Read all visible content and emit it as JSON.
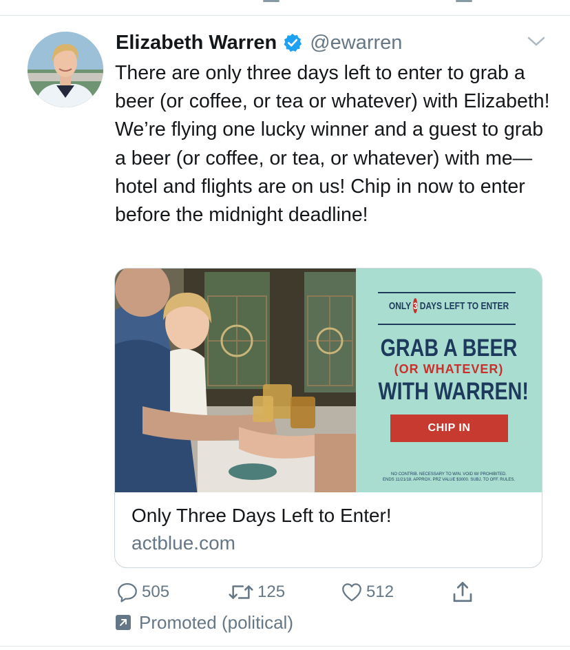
{
  "tweet": {
    "author_name": "Elizabeth Warren",
    "handle": "@ewarren",
    "text": "There are only three days left to enter to grab a beer (or coffee, or tea or whatever) with Elizabeth! We’re flying one lucky winner and a guest to grab a beer (or coffee, or tea, or whatever) with me—hotel and flights are on us! Chip in now to enter before the midnight deadline!"
  },
  "card": {
    "promo_only_prefix": "ONLY",
    "promo_days_number": "3",
    "promo_only_suffix": "DAYS LEFT TO ENTER",
    "promo_headline_1": "GRAB A BEER",
    "promo_headline_sub": "(OR WHATEVER)",
    "promo_headline_2": "WITH WARREN!",
    "promo_cta": "CHIP IN",
    "promo_fineprint_1": "No contrib. necessary to win. Void w/ prohibited.",
    "promo_fineprint_2": "Ends 11/21/18. Approx. prz value $3000. Subj. to off. rules.",
    "title": "Only Three Days Left to Enter!",
    "domain": "actblue.com"
  },
  "actions": {
    "replies": "505",
    "retweets": "125",
    "likes": "512"
  },
  "promoted_label": "Promoted (political)",
  "colors": {
    "verified_blue": "#1da1f2",
    "promo_mint": "#a9ddd0",
    "promo_navy": "#1d3a5c",
    "promo_red": "#c73a30",
    "muted_gray": "#657786"
  },
  "icons": [
    "verified-badge-icon",
    "chevron-down-icon",
    "reply-icon",
    "retweet-icon",
    "like-icon",
    "share-icon",
    "promoted-arrow-icon"
  ]
}
